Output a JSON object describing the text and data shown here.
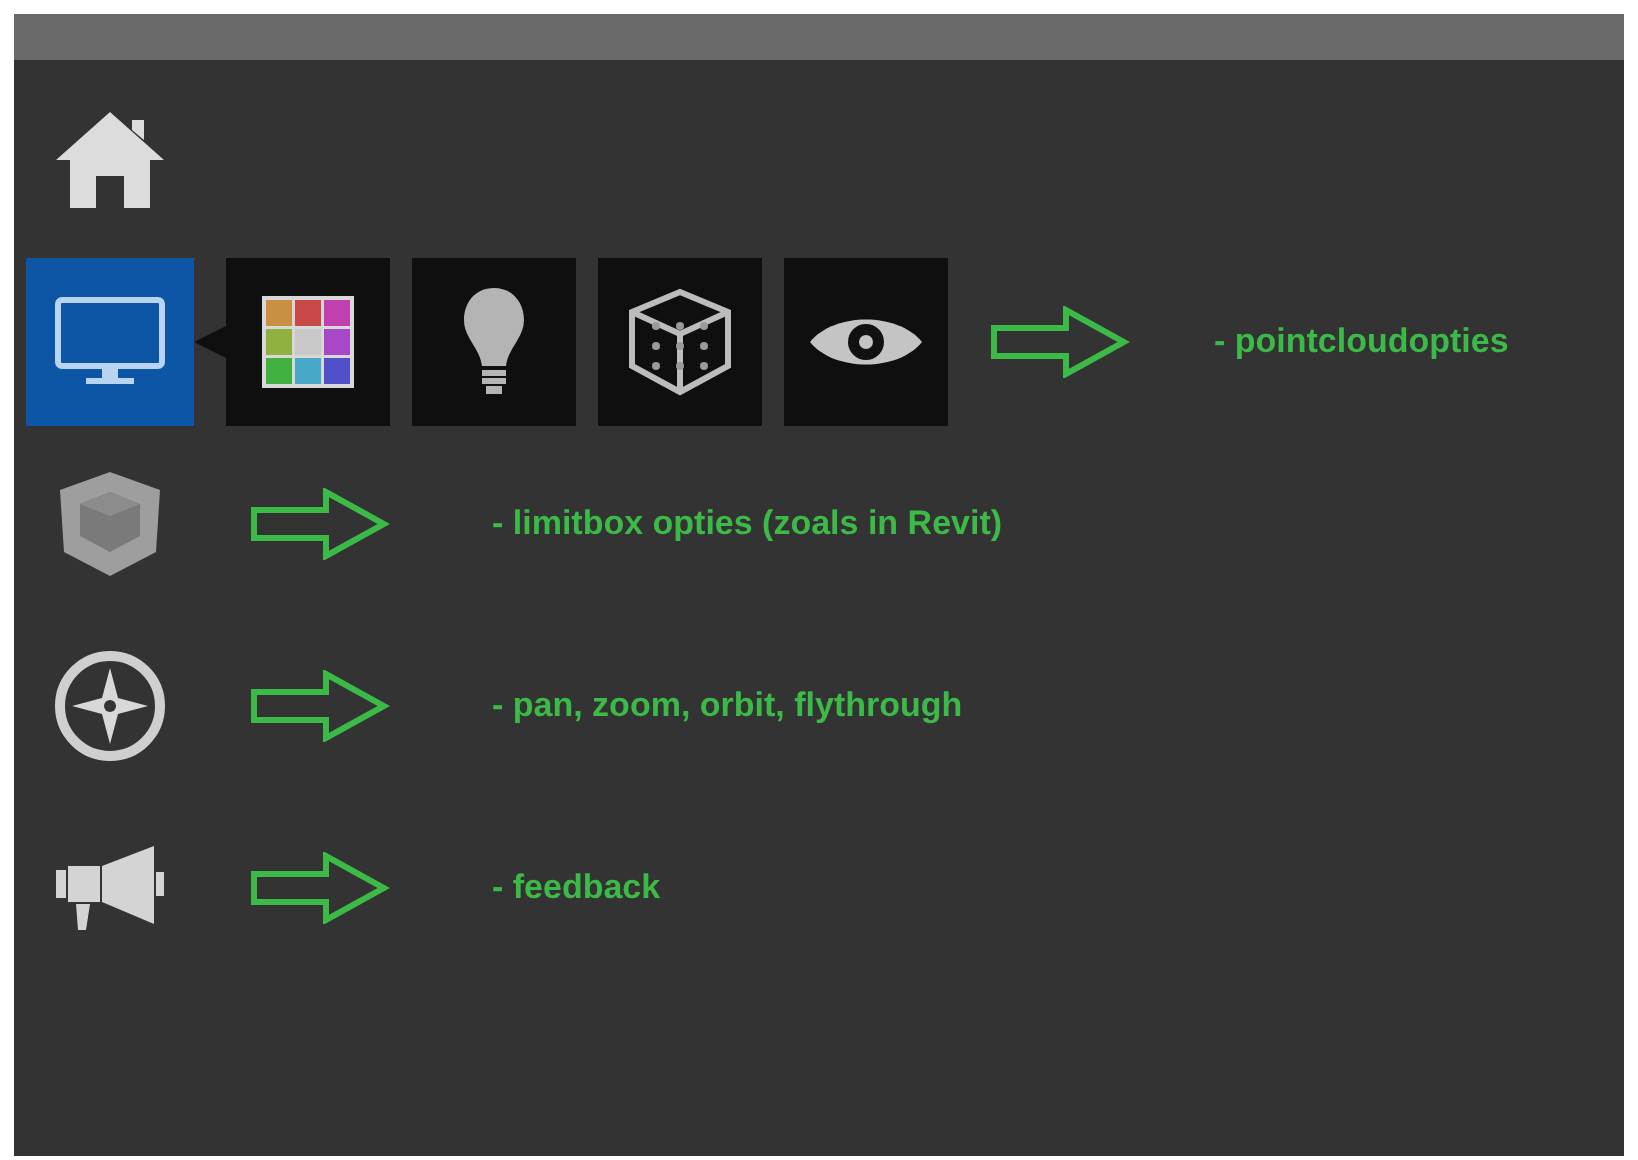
{
  "sidebar": {
    "items": [
      {
        "kind": "home",
        "selected": false
      },
      {
        "kind": "display",
        "selected": true,
        "submenu": [
          {
            "kind": "colors"
          },
          {
            "kind": "light"
          },
          {
            "kind": "pointcloud"
          },
          {
            "kind": "eye"
          }
        ],
        "note": "- pointcloudopties"
      },
      {
        "kind": "limitbox",
        "selected": false,
        "note": "- limitbox opties (zoals in Revit)"
      },
      {
        "kind": "navigation",
        "selected": false,
        "note": "- pan, zoom, orbit, flythrough"
      },
      {
        "kind": "feedback",
        "selected": false,
        "note": "- feedback"
      }
    ]
  }
}
